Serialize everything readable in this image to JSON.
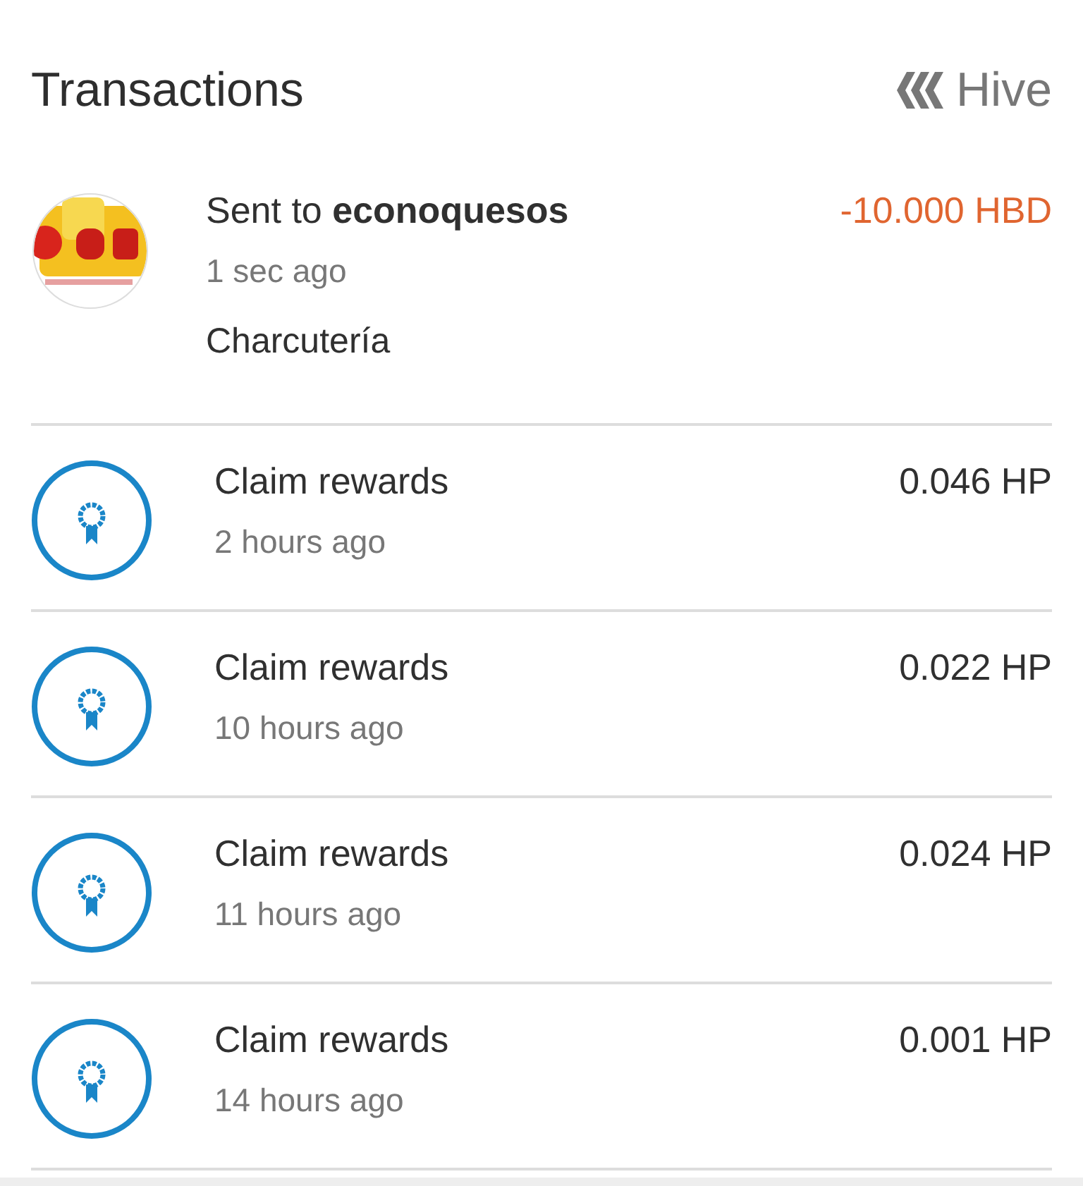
{
  "header": {
    "title": "Transactions",
    "network": "Hive"
  },
  "transactions": [
    {
      "kind": "transfer",
      "title": "Sent to **econoquesos**",
      "time": "1 sec ago",
      "memo": "Charcutería",
      "amount": "-10.000 HBD"
    },
    {
      "kind": "claim",
      "title": "Claim rewards",
      "time": "2 hours ago",
      "amount": "0.046 HP"
    },
    {
      "kind": "claim",
      "title": "Claim rewards",
      "time": "10 hours ago",
      "amount": "0.022 HP"
    },
    {
      "kind": "claim",
      "title": "Claim rewards",
      "time": "11 hours ago",
      "amount": "0.024 HP"
    },
    {
      "kind": "claim",
      "title": "Claim rewards",
      "time": "14 hours ago",
      "amount": "0.001 HP"
    }
  ]
}
